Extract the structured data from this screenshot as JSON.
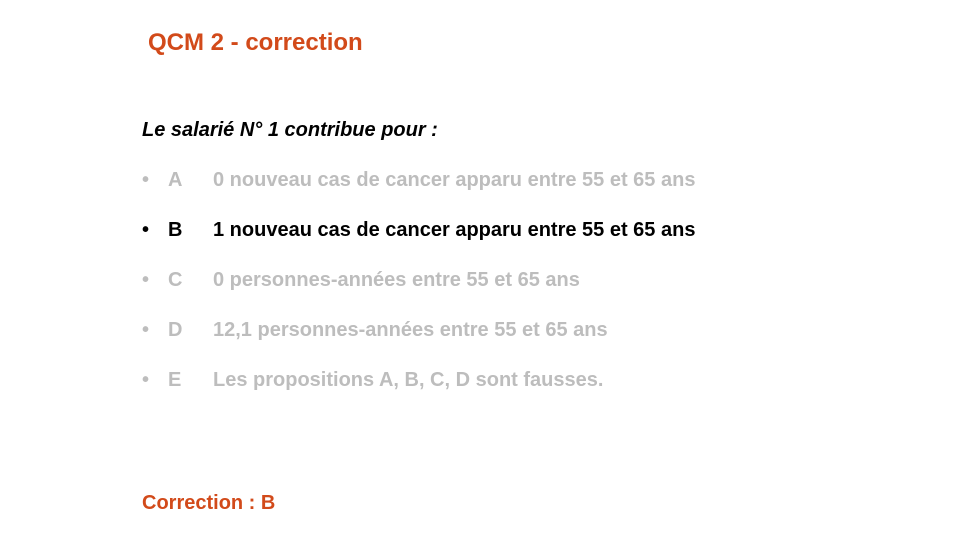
{
  "slide": {
    "title": "QCM 2 - correction",
    "question": "Le salarié N° 1 contribue pour :",
    "options": [
      {
        "bullet": "•",
        "letter": "A",
        "text": "0 nouveau cas de cancer apparu entre 55 et 65 ans",
        "correct": false
      },
      {
        "bullet": "•",
        "letter": "B",
        "text": "1 nouveau cas de cancer apparu entre 55 et 65 ans",
        "correct": true
      },
      {
        "bullet": "•",
        "letter": "C",
        "text": "0 personnes-années entre 55 et 65 ans",
        "correct": false
      },
      {
        "bullet": "•",
        "letter": "D",
        "text": "12,1 personnes-années entre 55 et 65 ans",
        "correct": false
      },
      {
        "bullet": "•",
        "letter": "E",
        "text": "Les propositions A, B, C, D sont fausses.",
        "correct": false
      }
    ],
    "footer": "Correction : B"
  },
  "colors": {
    "accent": "#D24A1A",
    "text": "#000000",
    "dimmed": "#BDBDBD"
  }
}
